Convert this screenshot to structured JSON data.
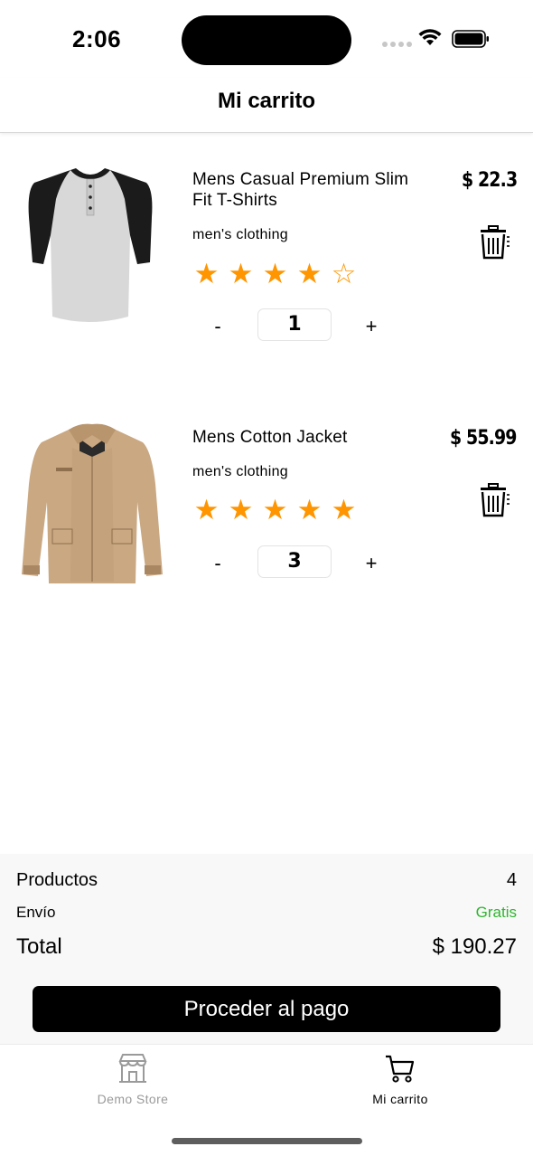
{
  "status": {
    "time": "2:06"
  },
  "header": {
    "title": "Mi carrito"
  },
  "cart": {
    "items": [
      {
        "title": "Mens Casual Premium Slim Fit T-Shirts",
        "category": "men's clothing",
        "price": "$ 22.3",
        "rating": 4,
        "rating_max": 5,
        "quantity": "1",
        "minus_label": "-",
        "plus_label": "+",
        "image_icon": "raglan-henley-shirt"
      },
      {
        "title": "Mens Cotton Jacket",
        "category": "men's clothing",
        "price": "$ 55.99",
        "rating": 5,
        "rating_max": 5,
        "quantity": "3",
        "minus_label": "-",
        "plus_label": "+",
        "image_icon": "beige-cotton-jacket"
      }
    ]
  },
  "summary": {
    "products_label": "Productos",
    "products_value": "4",
    "shipping_label": "Envío",
    "shipping_value": "Gratis",
    "total_label": "Total",
    "total_value": "$ 190.27",
    "checkout_label": "Proceder al pago"
  },
  "tabbar": {
    "tabs": [
      {
        "label": "Demo Store",
        "icon": "storefront-icon",
        "active": false
      },
      {
        "label": "Mi carrito",
        "icon": "cart-icon",
        "active": true
      }
    ]
  },
  "colors": {
    "star": "#ff9500",
    "free_shipping": "#2fb52f",
    "button": "#000000",
    "tab_inactive": "#9a9a9a"
  }
}
